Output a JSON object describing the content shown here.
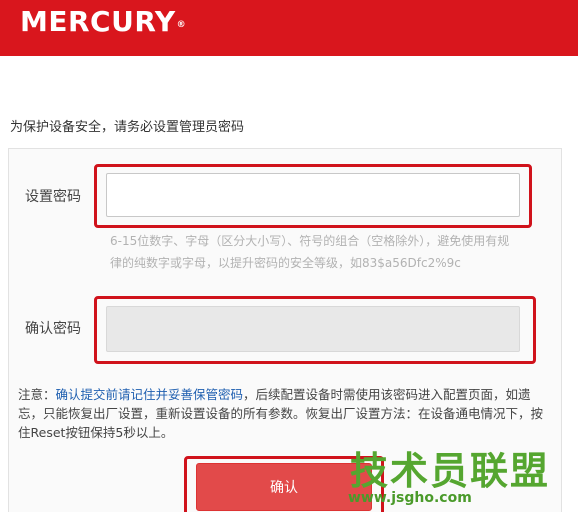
{
  "header": {
    "logo": "MERCURY",
    "logo_mark": "®",
    "color": "#d9161d"
  },
  "intro": "为保护设备安全，请务必设置管理员密码",
  "form": {
    "password_label": "设置密码",
    "password_value": "",
    "password_hint": "6-15位数字、字母（区分大小写）、符号的组合（空格除外），避免使用有规律的纯数字或字母，以提升密码的安全等级，如83$a56Dfc2%9c",
    "confirm_label": "确认密码",
    "confirm_value": ""
  },
  "note": {
    "prefix": "注意：",
    "emphasis": "确认提交前请记住并妥善保管密码",
    "rest": "，后续配置设备时需使用该密码进入配置页面，如遗忘，只能恢复出厂设置，重新设置设备的所有参数。恢复出厂设置方法：在设备通电情况下，按住Reset按钮保持5秒以上。"
  },
  "confirm_button": "确认",
  "highlight_color": "#d0121b",
  "watermark": {
    "text": "技术员联盟",
    "url": "www.jsgho.com"
  }
}
